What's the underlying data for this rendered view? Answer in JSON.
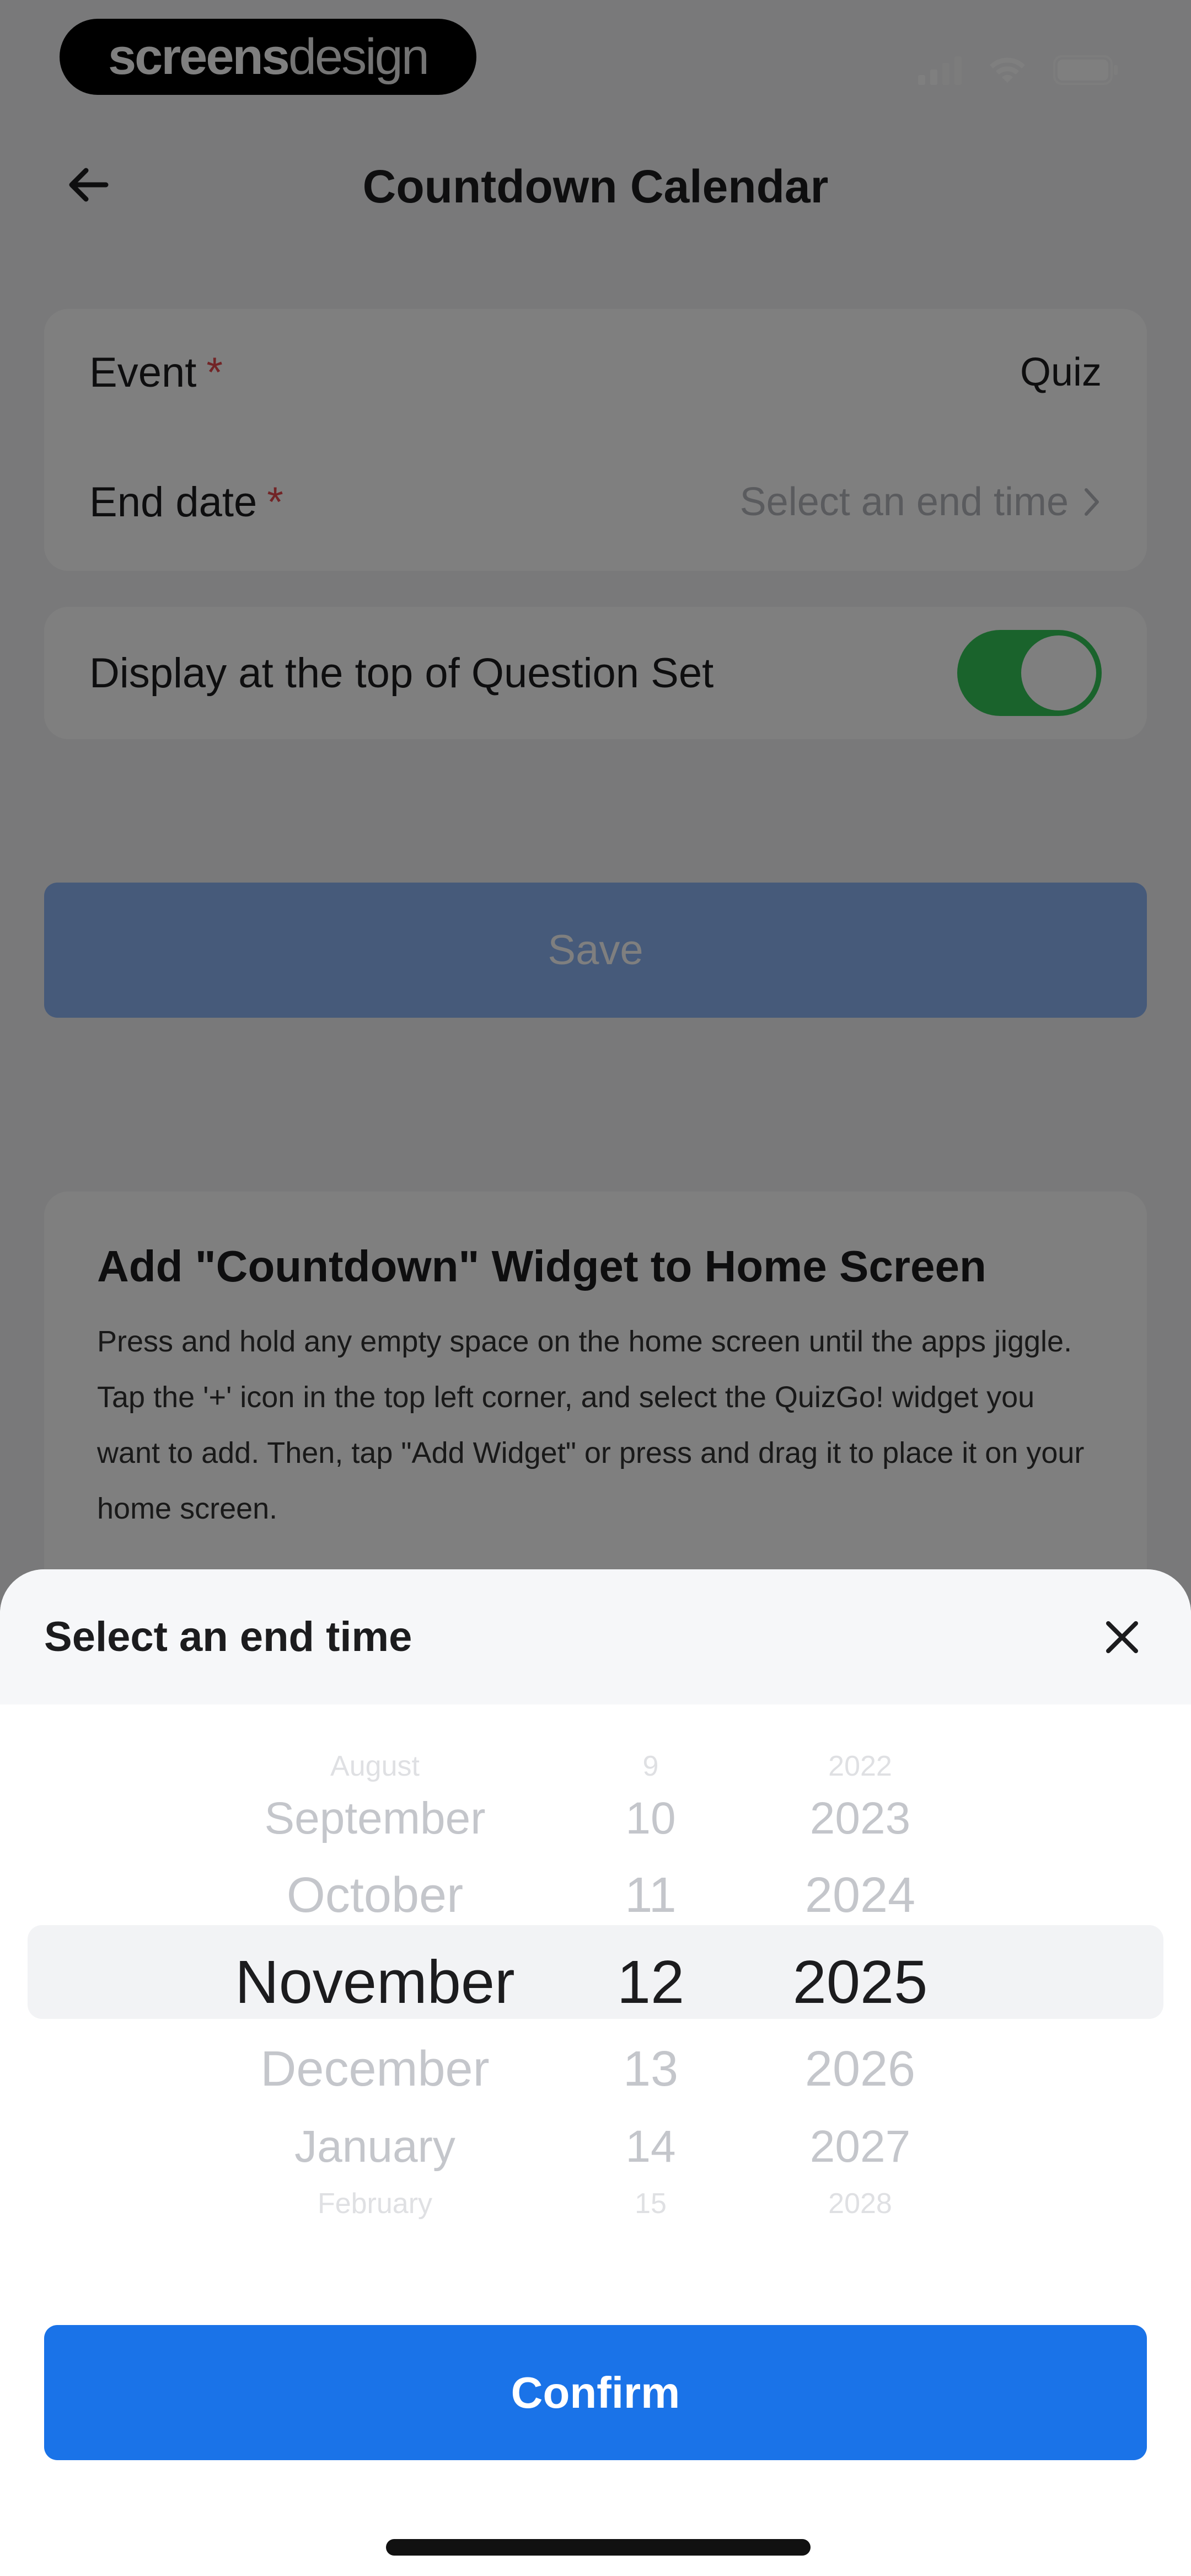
{
  "status_bar": {
    "brand_bold": "screens",
    "brand_light": "design"
  },
  "header": {
    "title": "Countdown Calendar"
  },
  "form": {
    "event_label": "Event",
    "event_value": "Quiz",
    "end_date_label": "End date",
    "end_date_placeholder": "Select an end time",
    "required_mark": "*"
  },
  "toggle": {
    "label": "Display at the top of Question Set",
    "on": true
  },
  "save_label": "Save",
  "widget_info": {
    "title": "Add \"Countdown\" Widget to Home Screen",
    "description": "Press and hold any empty space on the home screen until the apps jiggle. Tap the '+' icon in the top left corner, and select the QuizGo! widget you want to add. Then, tap \"Add Widget\" or press and drag it to place it on your home screen."
  },
  "sheet": {
    "title": "Select an end time",
    "months": [
      "August",
      "September",
      "October",
      "November",
      "December",
      "January",
      "February"
    ],
    "days": [
      "9",
      "10",
      "11",
      "12",
      "13",
      "14",
      "15"
    ],
    "years": [
      "2022",
      "2023",
      "2024",
      "2025",
      "2026",
      "2027",
      "2028"
    ],
    "selected": {
      "month": "November",
      "day": "12",
      "year": "2025"
    },
    "confirm_label": "Confirm"
  },
  "colors": {
    "accent": "#1a73e8",
    "save_disabled": "#8cb4f5",
    "toggle_on": "#34c759",
    "required": "#e5484d"
  }
}
